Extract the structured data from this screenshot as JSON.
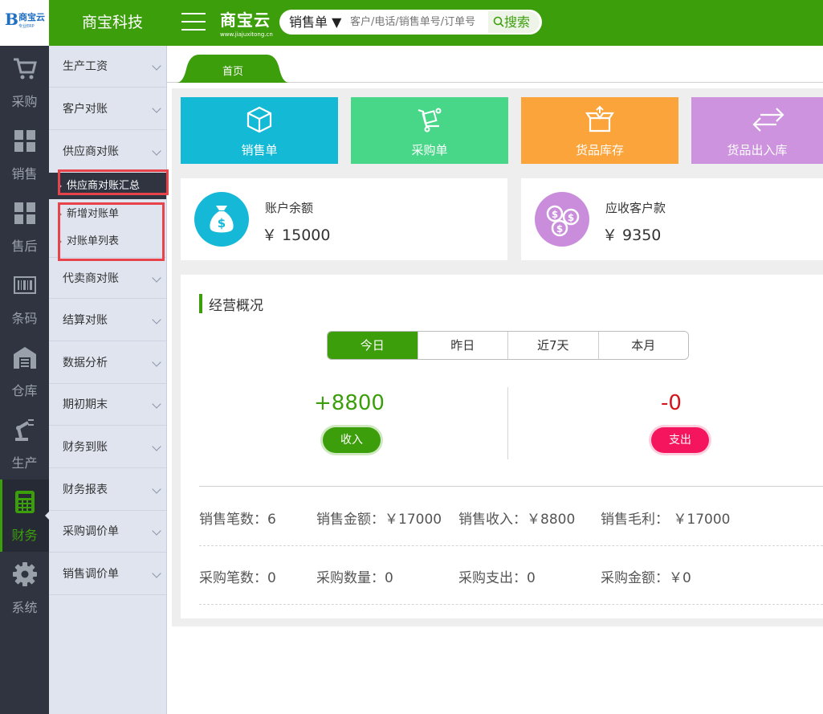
{
  "logo": {
    "mark": "B",
    "name": "商宝云",
    "sub": "专业ERP"
  },
  "header": {
    "company": "商宝科技",
    "brand_name": "商宝云",
    "brand_url": "www.jiajuxitong.cn",
    "search_type": "销售单 ▼",
    "search_placeholder": "客户/电话/销售单号/订单号",
    "search_button": "搜索"
  },
  "rail": {
    "items": [
      {
        "label": "采购",
        "icon": "cart-icon"
      },
      {
        "label": "销售",
        "icon": "boxes-icon"
      },
      {
        "label": "售后",
        "icon": "boxes-icon"
      },
      {
        "label": "条码",
        "icon": "barcode-icon"
      },
      {
        "label": "仓库",
        "icon": "warehouse-icon"
      },
      {
        "label": "生产",
        "icon": "robot-arm-icon"
      },
      {
        "label": "财务",
        "icon": "calculator-icon",
        "active": true
      },
      {
        "label": "系统",
        "icon": "gear-icon"
      }
    ]
  },
  "submenu": {
    "items": [
      "生产工资",
      "客户对账",
      "供应商对账",
      "代卖商对账",
      "结算对账",
      "数据分析",
      "期初期末",
      "财务到账",
      "财务报表",
      "采购调价单",
      "销售调价单"
    ],
    "sub_items": [
      "供应商对账汇总",
      "新增对账单",
      "对账单列表"
    ],
    "active_sub": "供应商对账汇总"
  },
  "tabs": {
    "home": "首页"
  },
  "tiles": [
    {
      "label": "销售单",
      "color": "#14b9d6",
      "icon": "box-icon"
    },
    {
      "label": "采购单",
      "color": "#48d688",
      "icon": "cart-dolly-icon"
    },
    {
      "label": "货品库存",
      "color": "#fca43c",
      "icon": "open-box-icon"
    },
    {
      "label": "货品出入库",
      "color": "#cd93de",
      "icon": "swap-arrows-icon"
    }
  ],
  "cards": {
    "balance": {
      "title": "账户余额",
      "value": "￥ 15000",
      "color": "#15b9d7"
    },
    "receivable": {
      "title": "应收客户款",
      "value": "￥ 9350",
      "color": "#c98ddc"
    }
  },
  "overview": {
    "title": "经营概况",
    "periods": [
      "今日",
      "昨日",
      "近7天",
      "本月"
    ],
    "active_period": "今日",
    "income": "+8800",
    "income_label": "收入",
    "expense": "-0",
    "expense_label": "支出",
    "sales_stats": [
      "销售笔数：6",
      "销售金额：￥17000",
      "销售收入：￥8800",
      "销售毛利：  ￥17000"
    ],
    "purchase_stats": [
      "采购笔数：0",
      "采购数量：0",
      "采购支出：0",
      "采购金额：￥0"
    ]
  },
  "colors": {
    "brand_green": "#3d9e0c",
    "rail_bg": "#2f3440",
    "submenu_bg": "#dfe4ef",
    "highlight_red": "#e8434b"
  }
}
